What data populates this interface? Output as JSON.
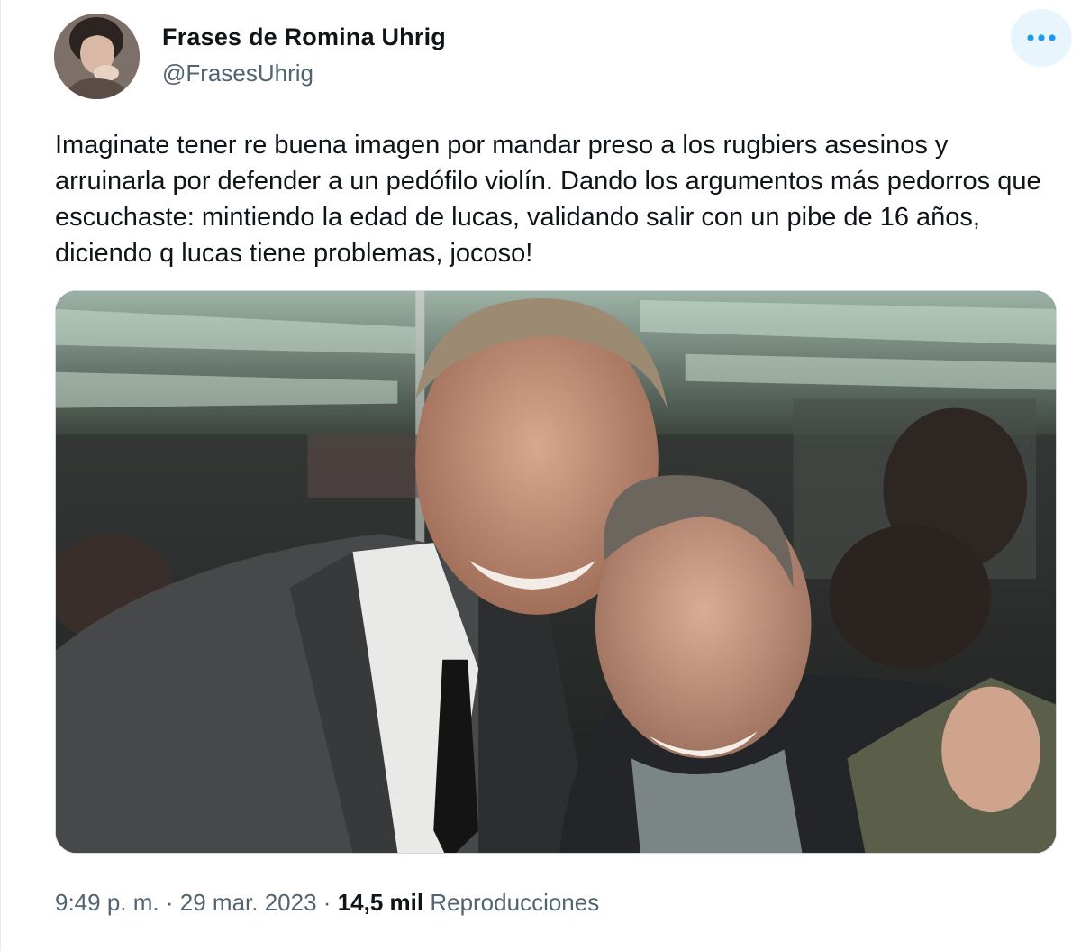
{
  "author": {
    "display_name": "Frases de Romina Uhrig",
    "handle": "@FrasesUhrig"
  },
  "more_button": {
    "icon": "more-horizontal-icon"
  },
  "tweet": {
    "text": "Imaginate tener re buena imagen por mandar preso a los rugbiers asesinos y arruinarla por defender a un pedófilo violín. Dando los argumentos más pedorros que escuchaste: mintiendo la edad de lucas, validando salir con un pibe de 16 años, diciendo q lucas tiene problemas, jocoso!"
  },
  "meta": {
    "time": "9:49 p. m.",
    "separator": "·",
    "date": "29 mar. 2023",
    "views_count": "14,5 mil",
    "views_label": "Reproducciones"
  },
  "colors": {
    "text_primary": "#0f1419",
    "text_secondary": "#536471",
    "accent": "#1d9bf0",
    "more_button_bg": "#e8f5fd"
  }
}
